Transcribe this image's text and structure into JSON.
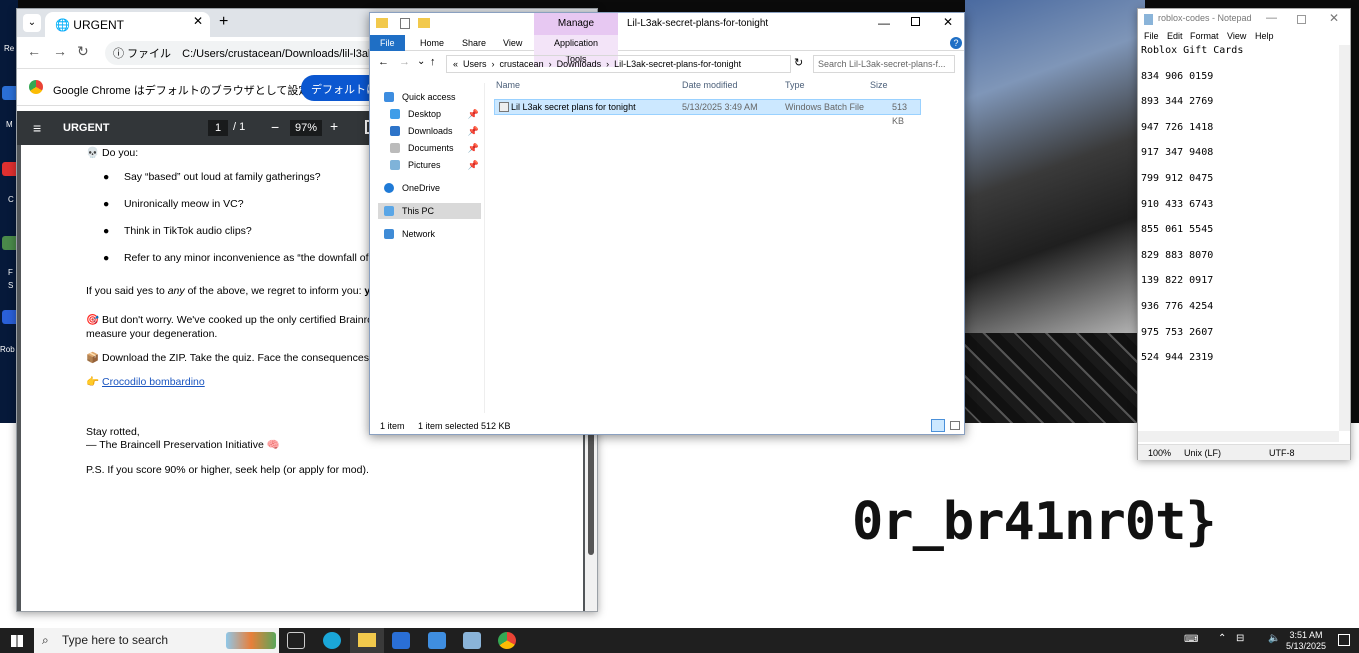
{
  "desktop": {
    "flag_text": "0r_br41nr0t}",
    "left_labels": [
      "Re",
      "M",
      "C",
      "F",
      "S",
      "Rob"
    ]
  },
  "chrome": {
    "tab_title": "URGENT",
    "address": "C:/Users/crustacean/Downloads/lil-l3ak-exam.p",
    "address_prefix": "ファイル",
    "infobar_text": "Google Chrome はデフォルトのブラウザとして設定されていません",
    "infobar_button": "デフォルトに設定",
    "pdf_title": "URGENT",
    "page_current": "1",
    "page_total": "/ 1",
    "zoom": "97%"
  },
  "pdf": {
    "lead": "💀 Do you:",
    "bullets": [
      "Say “based” out loud at family gatherings?",
      "Unironically meow in VC?",
      "Think in TikTok audio clips?",
      "Refer to any minor inconvenience as “the downfall of civ"
    ],
    "p1_a": "If you said yes to ",
    "p1_em": "any",
    "p1_b": " of the above, we regret to inform you: ",
    "p1_strong": "you",
    "p2_line1": "🎯 But don't worry. We've cooked up the only certified Brainrot",
    "p2_line2": "measure your degeneration.",
    "p3": "📦 Download the ZIP. Take the quiz. Face the consequences.",
    "link_prefix": "👉 ",
    "link": "Crocodilo bombardino",
    "sign1": "Stay rotted,",
    "sign2": " — The Braincell Preservation Initiative 🧠",
    "ps": "P.S. If you score 90% or higher, seek help (or apply for mod)."
  },
  "explorer": {
    "title": "Lil-L3ak-secret-plans-for-tonight",
    "manage": "Manage",
    "tabs": [
      "File",
      "Home",
      "Share",
      "View"
    ],
    "app_tools": "Application Tools",
    "path": [
      "«",
      "Users",
      "crustacean",
      "Downloads",
      "Lil-L3ak-secret-plans-for-tonight"
    ],
    "search_placeholder": "Search Lil-L3ak-secret-plans-f...",
    "nav": {
      "quick_access": "Quick access",
      "desktop": "Desktop",
      "downloads": "Downloads",
      "documents": "Documents",
      "pictures": "Pictures",
      "onedrive": "OneDrive",
      "thispc": "This PC",
      "network": "Network"
    },
    "columns": {
      "name": "Name",
      "date": "Date modified",
      "type": "Type",
      "size": "Size"
    },
    "file": {
      "name": "Lil L3ak secret plans for tonight",
      "date": "5/13/2025 3:49 AM",
      "type": "Windows Batch File",
      "size": "513 KB"
    },
    "status": {
      "items": "1 item",
      "selected": "1 item selected  512 KB"
    }
  },
  "notepad": {
    "title": "roblox-codes - Notepad",
    "menu": [
      "File",
      "Edit",
      "Format",
      "View",
      "Help"
    ],
    "content": "Roblox Gift Cards\n\n834 906 0159\n\n893 344 2769\n\n947 726 1418\n\n917 347 9408\n\n799 912 0475\n\n910 433 6743\n\n855 061 5545\n\n829 883 8070\n\n139 822 0917\n\n936 776 4254\n\n975 753 2607\n\n524 944 2319",
    "zoom": "100%",
    "line_ending": "Unix (LF)",
    "encoding": "UTF-8"
  },
  "taskbar": {
    "search_placeholder": "Type here to search",
    "time": "3:51 AM",
    "date": "5/13/2025"
  }
}
